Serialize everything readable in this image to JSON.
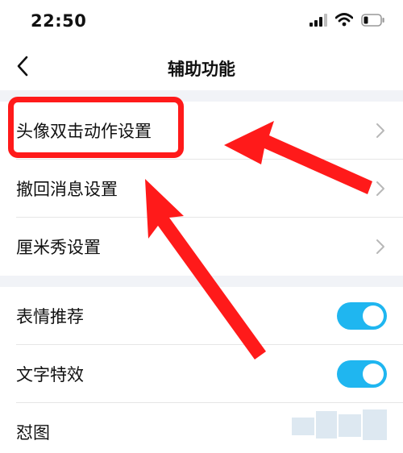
{
  "status_bar": {
    "time": "22:50",
    "icons": [
      "cellular-signal-icon",
      "wifi-icon",
      "battery-icon"
    ]
  },
  "nav": {
    "back_icon": "chevron-left-icon",
    "title": "辅助功能"
  },
  "section1": {
    "items": [
      {
        "label": "头像双击动作设置",
        "accessory": "chevron-right-icon"
      },
      {
        "label": "撤回消息设置",
        "accessory": "chevron-right-icon"
      },
      {
        "label": "厘米秀设置",
        "accessory": "chevron-right-icon"
      }
    ]
  },
  "section2": {
    "items": [
      {
        "label": "表情推荐",
        "toggle_on": true
      },
      {
        "label": "文字特效",
        "toggle_on": true
      },
      {
        "label": "怼图"
      }
    ]
  },
  "annotations": {
    "highlight_color": "#ff1a1a",
    "arrow_color": "#ff1a1a"
  },
  "colors": {
    "toggle_on": "#1fb6f0",
    "section_gap": "#f1f3f7"
  }
}
